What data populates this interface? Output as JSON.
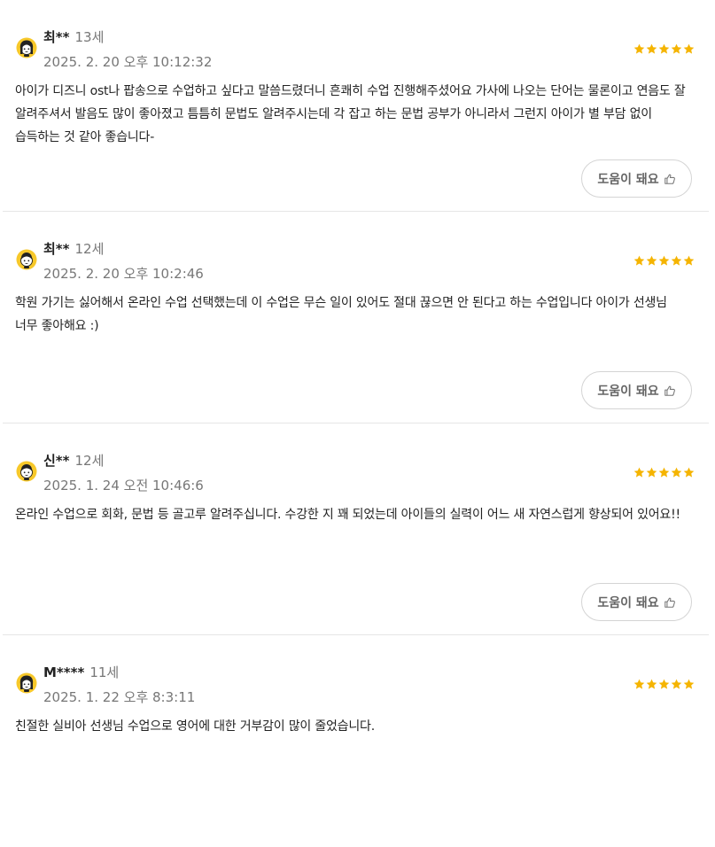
{
  "colors": {
    "star": "#f5b400",
    "avatar_bg": "#f7c82a",
    "divider": "#e6e6e6"
  },
  "reviews": [
    {
      "name": "최**",
      "age": "13세",
      "date": "2025. 2. 20 오후 10:12:32",
      "rating": 5,
      "avatar_icon": "girl-avatar-icon",
      "text": "아이가 디즈니 ost나 팝송으로 수업하고 싶다고 말씀드렸더니 흔쾌히 수업 진행해주셨어요 가사에 나오는 단어는 물론이고 연음도 잘 알려주셔서 발음도 많이 좋아졌고 틈틈히 문법도 알려주시는데 각 잡고 하는 문법 공부가 아니라서 그런지 아이가 별 부담 없이 습득하는 것 같아 좋습니다-",
      "helpful_label": "도움이 돼요"
    },
    {
      "name": "최**",
      "age": "12세",
      "date": "2025. 2. 20 오후 10:2:46",
      "rating": 5,
      "avatar_icon": "boy-avatar-icon",
      "text": "학원 가기는 싫어해서 온라인 수업 선택했는데 이 수업은 무슨 일이 있어도 절대 끊으면 안 된다고 하는 수업입니다 아이가 선생님 너무 좋아해요 :)",
      "helpful_label": "도움이 돼요"
    },
    {
      "name": "신**",
      "age": "12세",
      "date": "2025. 1. 24 오전 10:46:6",
      "rating": 5,
      "avatar_icon": "boy-avatar-icon",
      "text": "온라인 수업으로 회화, 문법 등 골고루 알려주십니다. 수강한 지 꽤 되었는데 아이들의 실력이 어느 새 자연스럽게 향상되어 있어요!!",
      "helpful_label": "도움이 돼요"
    },
    {
      "name": "M****",
      "age": "11세",
      "date": "2025. 1. 22 오후 8:3:11",
      "rating": 5,
      "avatar_icon": "girl-avatar-icon",
      "text": "친절한 실비아 선생님 수업으로 영어에 대한 거부감이 많이 줄었습니다.",
      "helpful_label": "도움이 돼요"
    }
  ]
}
